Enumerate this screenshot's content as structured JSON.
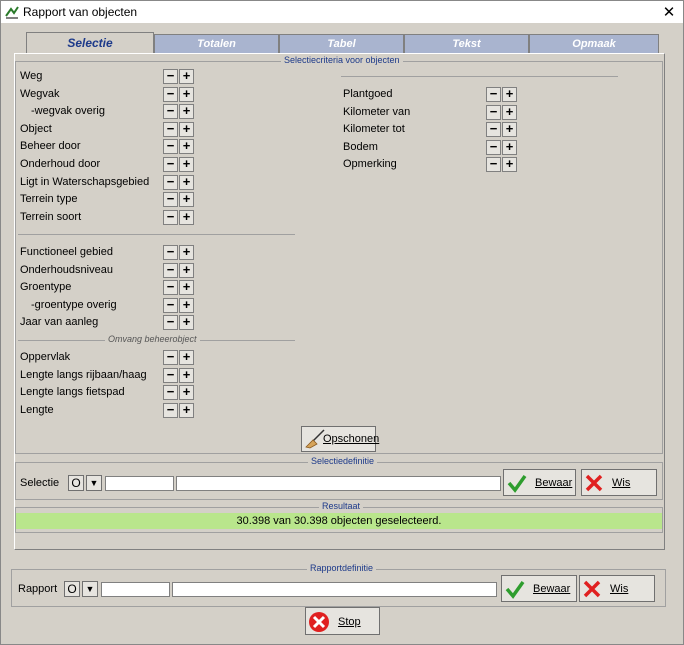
{
  "window": {
    "title": "Rapport van objecten",
    "close_glyph": "✕"
  },
  "tabs": [
    {
      "label": "Selectie",
      "active": true
    },
    {
      "label": "Totalen",
      "active": false
    },
    {
      "label": "Tabel",
      "active": false
    },
    {
      "label": "Tekst",
      "active": false
    },
    {
      "label": "Opmaak",
      "active": false
    }
  ],
  "criteria": {
    "group_title": "Selectiecriteria voor objecten",
    "minus": "−",
    "plus": "+",
    "left_items_1": [
      "Weg",
      "Wegvak",
      "-wegvak overig",
      "Object",
      "Beheer door",
      "Onderhoud door",
      "Ligt in Waterschapsgebied",
      "Terrein type",
      "Terrein soort"
    ],
    "left_items_2": [
      "Functioneel gebied",
      "Onderhoudsniveau",
      "Groentype",
      "-groentype overig",
      "Jaar van aanleg"
    ],
    "omvang_title": "Omvang beheerobject",
    "left_items_3": [
      "Oppervlak",
      "Lengte langs rijbaan/haag",
      "Lengte langs fietspad",
      "Lengte"
    ],
    "right_items": [
      "Plantgoed",
      "Kilometer van",
      "Kilometer tot",
      "Bodem",
      "Opmerking"
    ],
    "clear_button": "Opschonen"
  },
  "selectiedefinitie": {
    "group_title": "Selectiedefinitie",
    "label": "Selectie",
    "open_button": "O",
    "dropdown_glyph": "▼",
    "code_value": "",
    "name_value": "",
    "save_button": "Bewaar",
    "clear_button": "Wis"
  },
  "resultaat": {
    "group_title": "Resultaat",
    "text": "30.398 van 30.398 objecten geselecteerd."
  },
  "rapportdefinitie": {
    "group_title": "Rapportdefinitie",
    "label": "Rapport",
    "open_button": "O",
    "dropdown_glyph": "▼",
    "code_value": "",
    "name_value": "",
    "save_button": "Bewaar",
    "clear_button": "Wis"
  },
  "stop_button": "Stop",
  "colors": {
    "tab_inactive": "#a9b4cf",
    "tab_active_text": "#1d3a8a",
    "result_bg": "#b9e68c",
    "check": "#2e9d2e",
    "cross": "#e02020"
  }
}
